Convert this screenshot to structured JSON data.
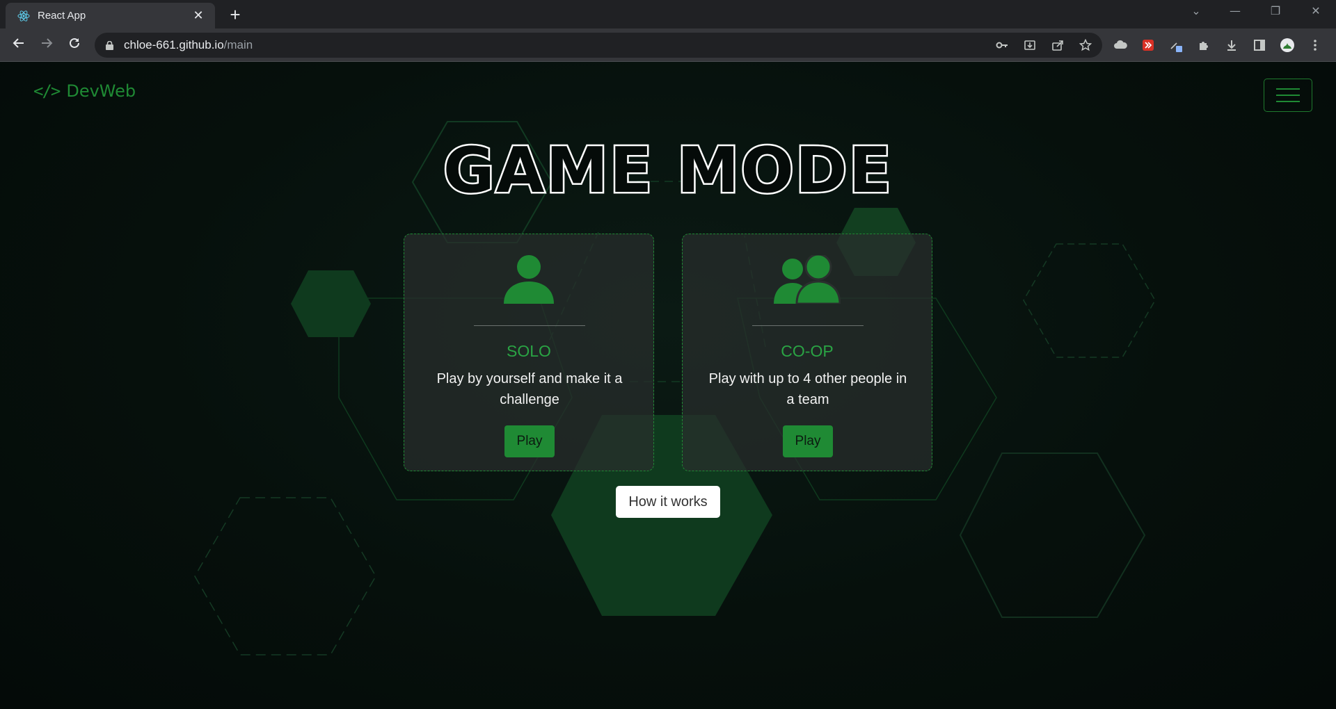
{
  "browser": {
    "tab_title": "React App",
    "url_host": "chloe-661.github.io",
    "url_path": "/main",
    "icons": [
      "react-favicon",
      "close-icon",
      "plus-icon",
      "chevron-down-icon",
      "minimize-icon",
      "restore-icon",
      "window-close-icon",
      "back-icon",
      "forward-icon",
      "reload-icon",
      "lock-icon",
      "key-icon",
      "install-icon",
      "share-icon",
      "star-icon",
      "extension-cloud-icon",
      "extension-red-icon",
      "extension-dropper-icon",
      "puzzle-icon",
      "download-icon",
      "sidepanel-icon",
      "profile-avatar",
      "kebab-menu-icon"
    ]
  },
  "nav": {
    "brand_code": "</>",
    "brand_name": "DevWeb"
  },
  "main": {
    "title": "GAME MODE",
    "cards": [
      {
        "mode": "SOLO",
        "description": "Play by yourself and make it a challenge",
        "button": "Play",
        "icon": "user-icon"
      },
      {
        "mode": "CO-OP",
        "description": "Play with up to 4 other people in a team",
        "button": "Play",
        "icon": "users-icon"
      }
    ],
    "how_button": "How it works"
  },
  "colors": {
    "accent": "#1f8a34",
    "accent_text": "#2aa444",
    "background": "#050b09",
    "card": "#2a302e"
  }
}
